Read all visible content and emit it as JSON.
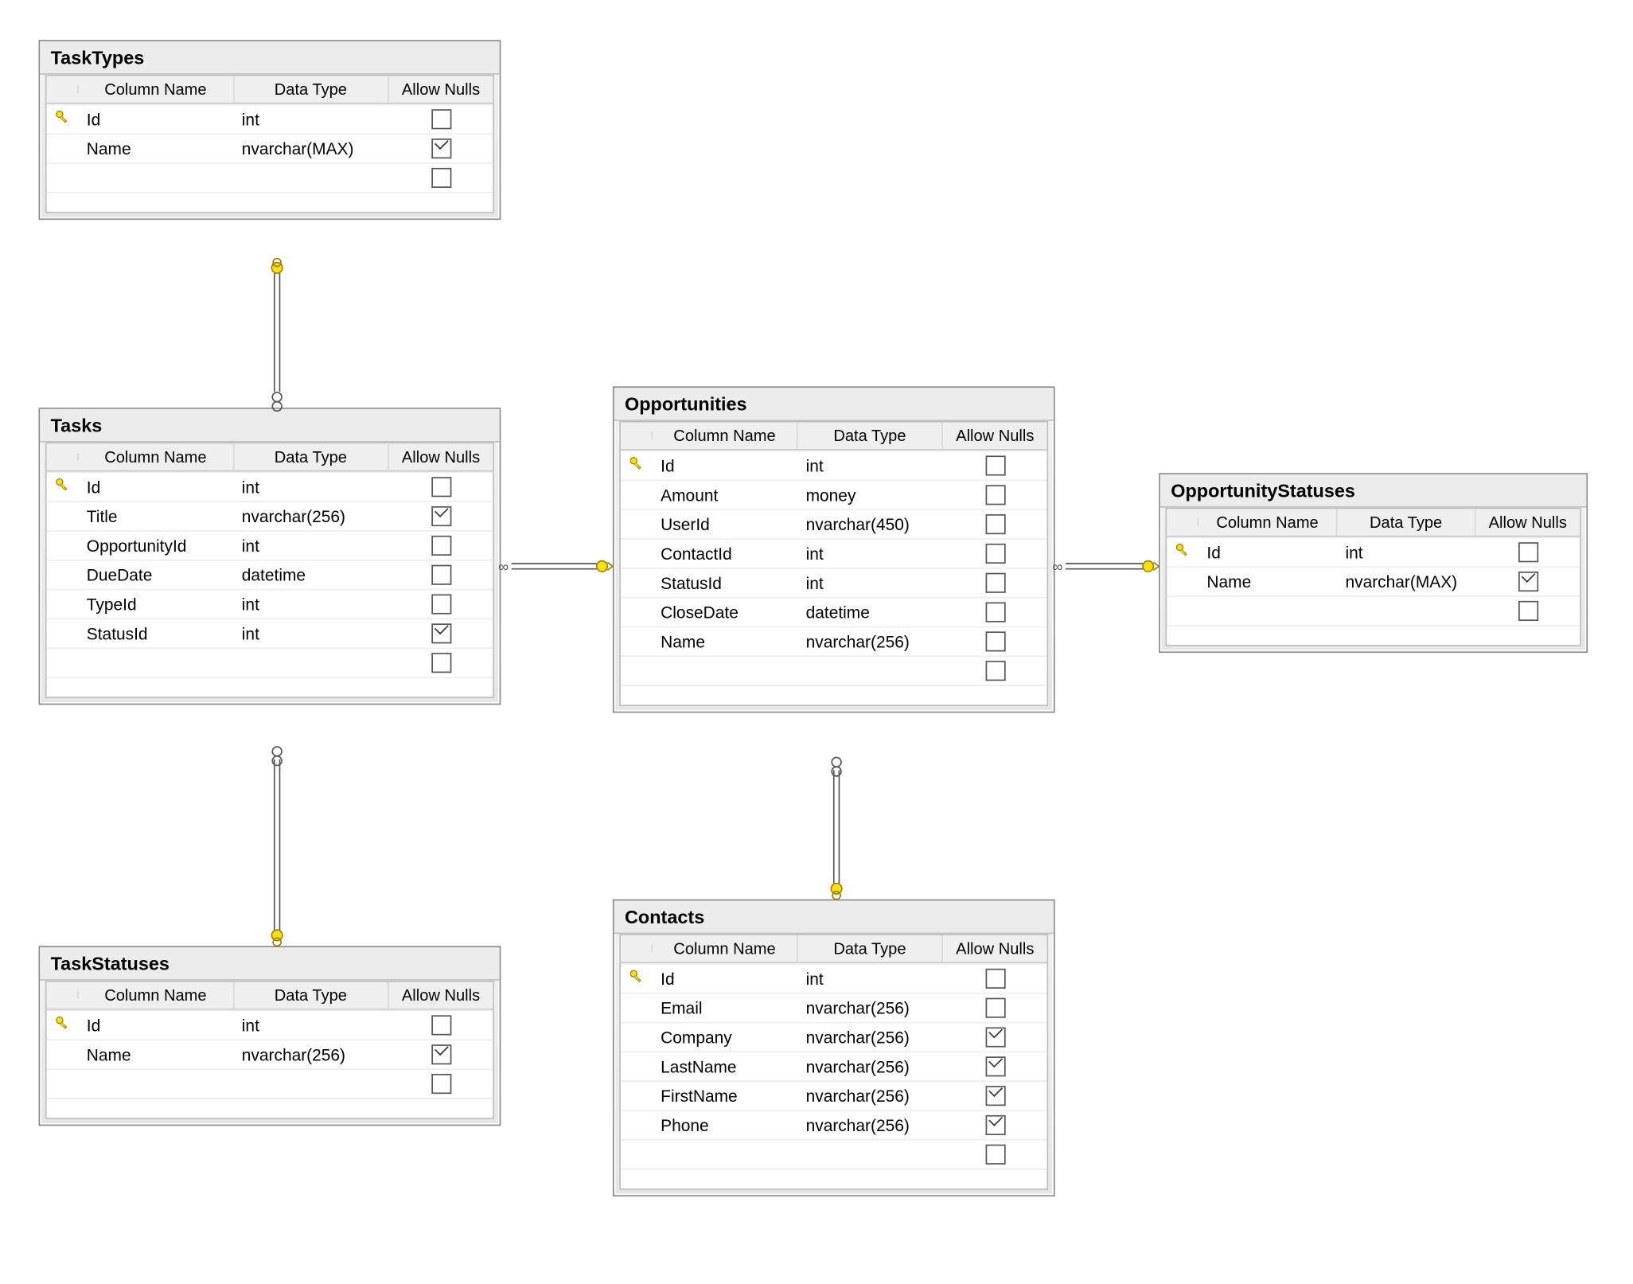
{
  "headers": {
    "col": "Column Name",
    "type": "Data Type",
    "nulls": "Allow Nulls"
  },
  "tasktypes": {
    "title": "TaskTypes",
    "rows": [
      {
        "pk": true,
        "name": "Id",
        "type": "int",
        "nulls": false
      },
      {
        "pk": false,
        "name": "Name",
        "type": "nvarchar(MAX)",
        "nulls": true
      }
    ]
  },
  "tasks": {
    "title": "Tasks",
    "rows": [
      {
        "pk": true,
        "name": "Id",
        "type": "int",
        "nulls": false
      },
      {
        "pk": false,
        "name": "Title",
        "type": "nvarchar(256)",
        "nulls": true
      },
      {
        "pk": false,
        "name": "OpportunityId",
        "type": "int",
        "nulls": false
      },
      {
        "pk": false,
        "name": "DueDate",
        "type": "datetime",
        "nulls": false
      },
      {
        "pk": false,
        "name": "TypeId",
        "type": "int",
        "nulls": false
      },
      {
        "pk": false,
        "name": "StatusId",
        "type": "int",
        "nulls": true
      }
    ]
  },
  "taskstatuses": {
    "title": "TaskStatuses",
    "rows": [
      {
        "pk": true,
        "name": "Id",
        "type": "int",
        "nulls": false
      },
      {
        "pk": false,
        "name": "Name",
        "type": "nvarchar(256)",
        "nulls": true
      }
    ]
  },
  "opportunities": {
    "title": "Opportunities",
    "rows": [
      {
        "pk": true,
        "name": "Id",
        "type": "int",
        "nulls": false
      },
      {
        "pk": false,
        "name": "Amount",
        "type": "money",
        "nulls": false
      },
      {
        "pk": false,
        "name": "UserId",
        "type": "nvarchar(450)",
        "nulls": false
      },
      {
        "pk": false,
        "name": "ContactId",
        "type": "int",
        "nulls": false
      },
      {
        "pk": false,
        "name": "StatusId",
        "type": "int",
        "nulls": false
      },
      {
        "pk": false,
        "name": "CloseDate",
        "type": "datetime",
        "nulls": false
      },
      {
        "pk": false,
        "name": "Name",
        "type": "nvarchar(256)",
        "nulls": false
      }
    ]
  },
  "opportunitystatuses": {
    "title": "OpportunityStatuses",
    "rows": [
      {
        "pk": true,
        "name": "Id",
        "type": "int",
        "nulls": false
      },
      {
        "pk": false,
        "name": "Name",
        "type": "nvarchar(MAX)",
        "nulls": true
      }
    ]
  },
  "contacts": {
    "title": "Contacts",
    "rows": [
      {
        "pk": true,
        "name": "Id",
        "type": "int",
        "nulls": false
      },
      {
        "pk": false,
        "name": "Email",
        "type": "nvarchar(256)",
        "nulls": false
      },
      {
        "pk": false,
        "name": "Company",
        "type": "nvarchar(256)",
        "nulls": true
      },
      {
        "pk": false,
        "name": "LastName",
        "type": "nvarchar(256)",
        "nulls": true
      },
      {
        "pk": false,
        "name": "FirstName",
        "type": "nvarchar(256)",
        "nulls": true
      },
      {
        "pk": false,
        "name": "Phone",
        "type": "nvarchar(256)",
        "nulls": true
      }
    ]
  }
}
